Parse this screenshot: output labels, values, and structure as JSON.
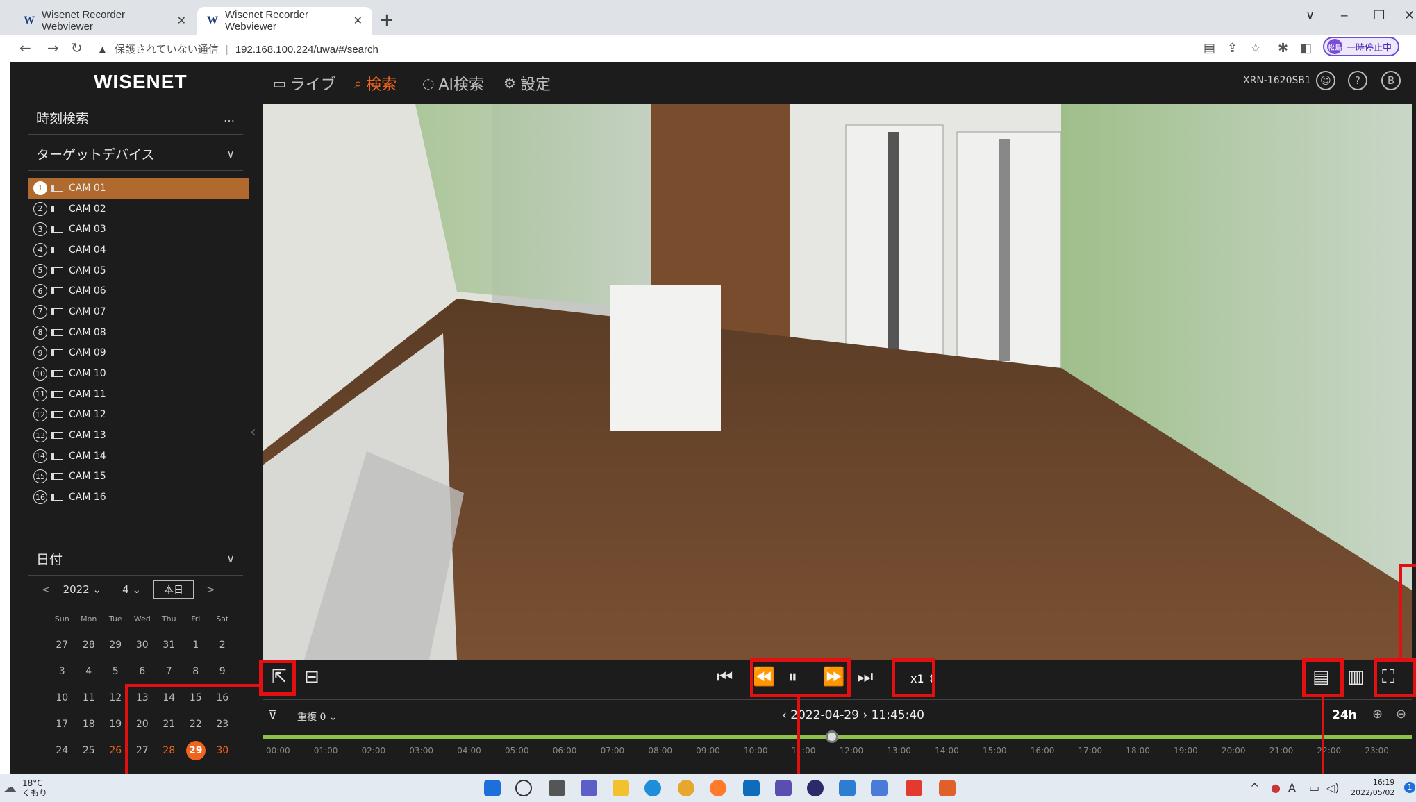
{
  "browser": {
    "tabs": [
      {
        "label": "Wisenet Recorder Webviewer",
        "favicon": "W"
      },
      {
        "label": "Wisenet Recorder Webviewer",
        "favicon": "W"
      }
    ],
    "new_tab": "+",
    "window_controls": {
      "minimize": "‒",
      "maximize": "❐",
      "close": "✕",
      "dropdown": "∨"
    },
    "address": {
      "security_label": "保護されていない通信",
      "url": "192.168.100.224/uwa/#/search"
    },
    "pause_badge": "一時停止中",
    "profile_initials": "松島"
  },
  "app": {
    "logo": "WISENET",
    "nav": [
      {
        "label": "ライブ",
        "icon": "monitor-icon"
      },
      {
        "label": "検索",
        "icon": "search-icon"
      },
      {
        "label": "AI検索",
        "icon": "ai-search-icon"
      },
      {
        "label": "設定",
        "icon": "gear-icon"
      }
    ],
    "model": "XRN-1620SB1"
  },
  "sidebar": {
    "section_title": "時刻検索",
    "section_menu": "…",
    "target_device_label": "ターゲットデバイス",
    "cameras": [
      {
        "num": "1",
        "label": "CAM 01",
        "selected": true
      },
      {
        "num": "2",
        "label": "CAM 02"
      },
      {
        "num": "3",
        "label": "CAM 03"
      },
      {
        "num": "4",
        "label": "CAM 04"
      },
      {
        "num": "5",
        "label": "CAM 05"
      },
      {
        "num": "6",
        "label": "CAM 06"
      },
      {
        "num": "7",
        "label": "CAM 07"
      },
      {
        "num": "8",
        "label": "CAM 08"
      },
      {
        "num": "9",
        "label": "CAM 09"
      },
      {
        "num": "10",
        "label": "CAM 10"
      },
      {
        "num": "11",
        "label": "CAM 11"
      },
      {
        "num": "12",
        "label": "CAM 12"
      },
      {
        "num": "13",
        "label": "CAM 13"
      },
      {
        "num": "14",
        "label": "CAM 14"
      },
      {
        "num": "15",
        "label": "CAM 15"
      },
      {
        "num": "16",
        "label": "CAM 16"
      }
    ],
    "date_label": "日付",
    "calendar": {
      "year": "2022",
      "month": "4",
      "today_button": "本日",
      "prev": "<",
      "next": ">",
      "weekdays": [
        "Sun",
        "Mon",
        "Tue",
        "Wed",
        "Thu",
        "Fri",
        "Sat"
      ],
      "weeks": [
        [
          "27",
          "28",
          "29",
          "30",
          "31",
          "1",
          "2"
        ],
        [
          "3",
          "4",
          "5",
          "6",
          "7",
          "8",
          "9"
        ],
        [
          "10",
          "11",
          "12",
          "13",
          "14",
          "15",
          "16"
        ],
        [
          "17",
          "18",
          "19",
          "20",
          "21",
          "22",
          "23"
        ],
        [
          "24",
          "25",
          "26",
          "27",
          "28",
          "29",
          "30"
        ]
      ],
      "recorded_days": [
        "26",
        "28",
        "30"
      ],
      "selected_day": "29"
    }
  },
  "player": {
    "speed": "x1",
    "timeline_date": "2022-04-29",
    "timeline_time": "11:45:40",
    "overlap_label": "重複 0",
    "range": "24h",
    "hours": [
      "00:00",
      "01:00",
      "02:00",
      "03:00",
      "04:00",
      "05:00",
      "06:00",
      "07:00",
      "08:00",
      "09:00",
      "10:00",
      "11:00",
      "12:00",
      "13:00",
      "14:00",
      "15:00",
      "16:00",
      "17:00",
      "18:00",
      "19:00",
      "20:00",
      "21:00",
      "22:00",
      "23:00"
    ],
    "playhead_fraction": 0.49
  },
  "taskbar": {
    "weather_temp": "18°C",
    "weather_text": "くもり",
    "clock_time": "16:19",
    "clock_date": "2022/05/02"
  },
  "colors": {
    "accent": "#f0641e",
    "annotation": "#e21010",
    "timeline": "#8bc34a"
  }
}
